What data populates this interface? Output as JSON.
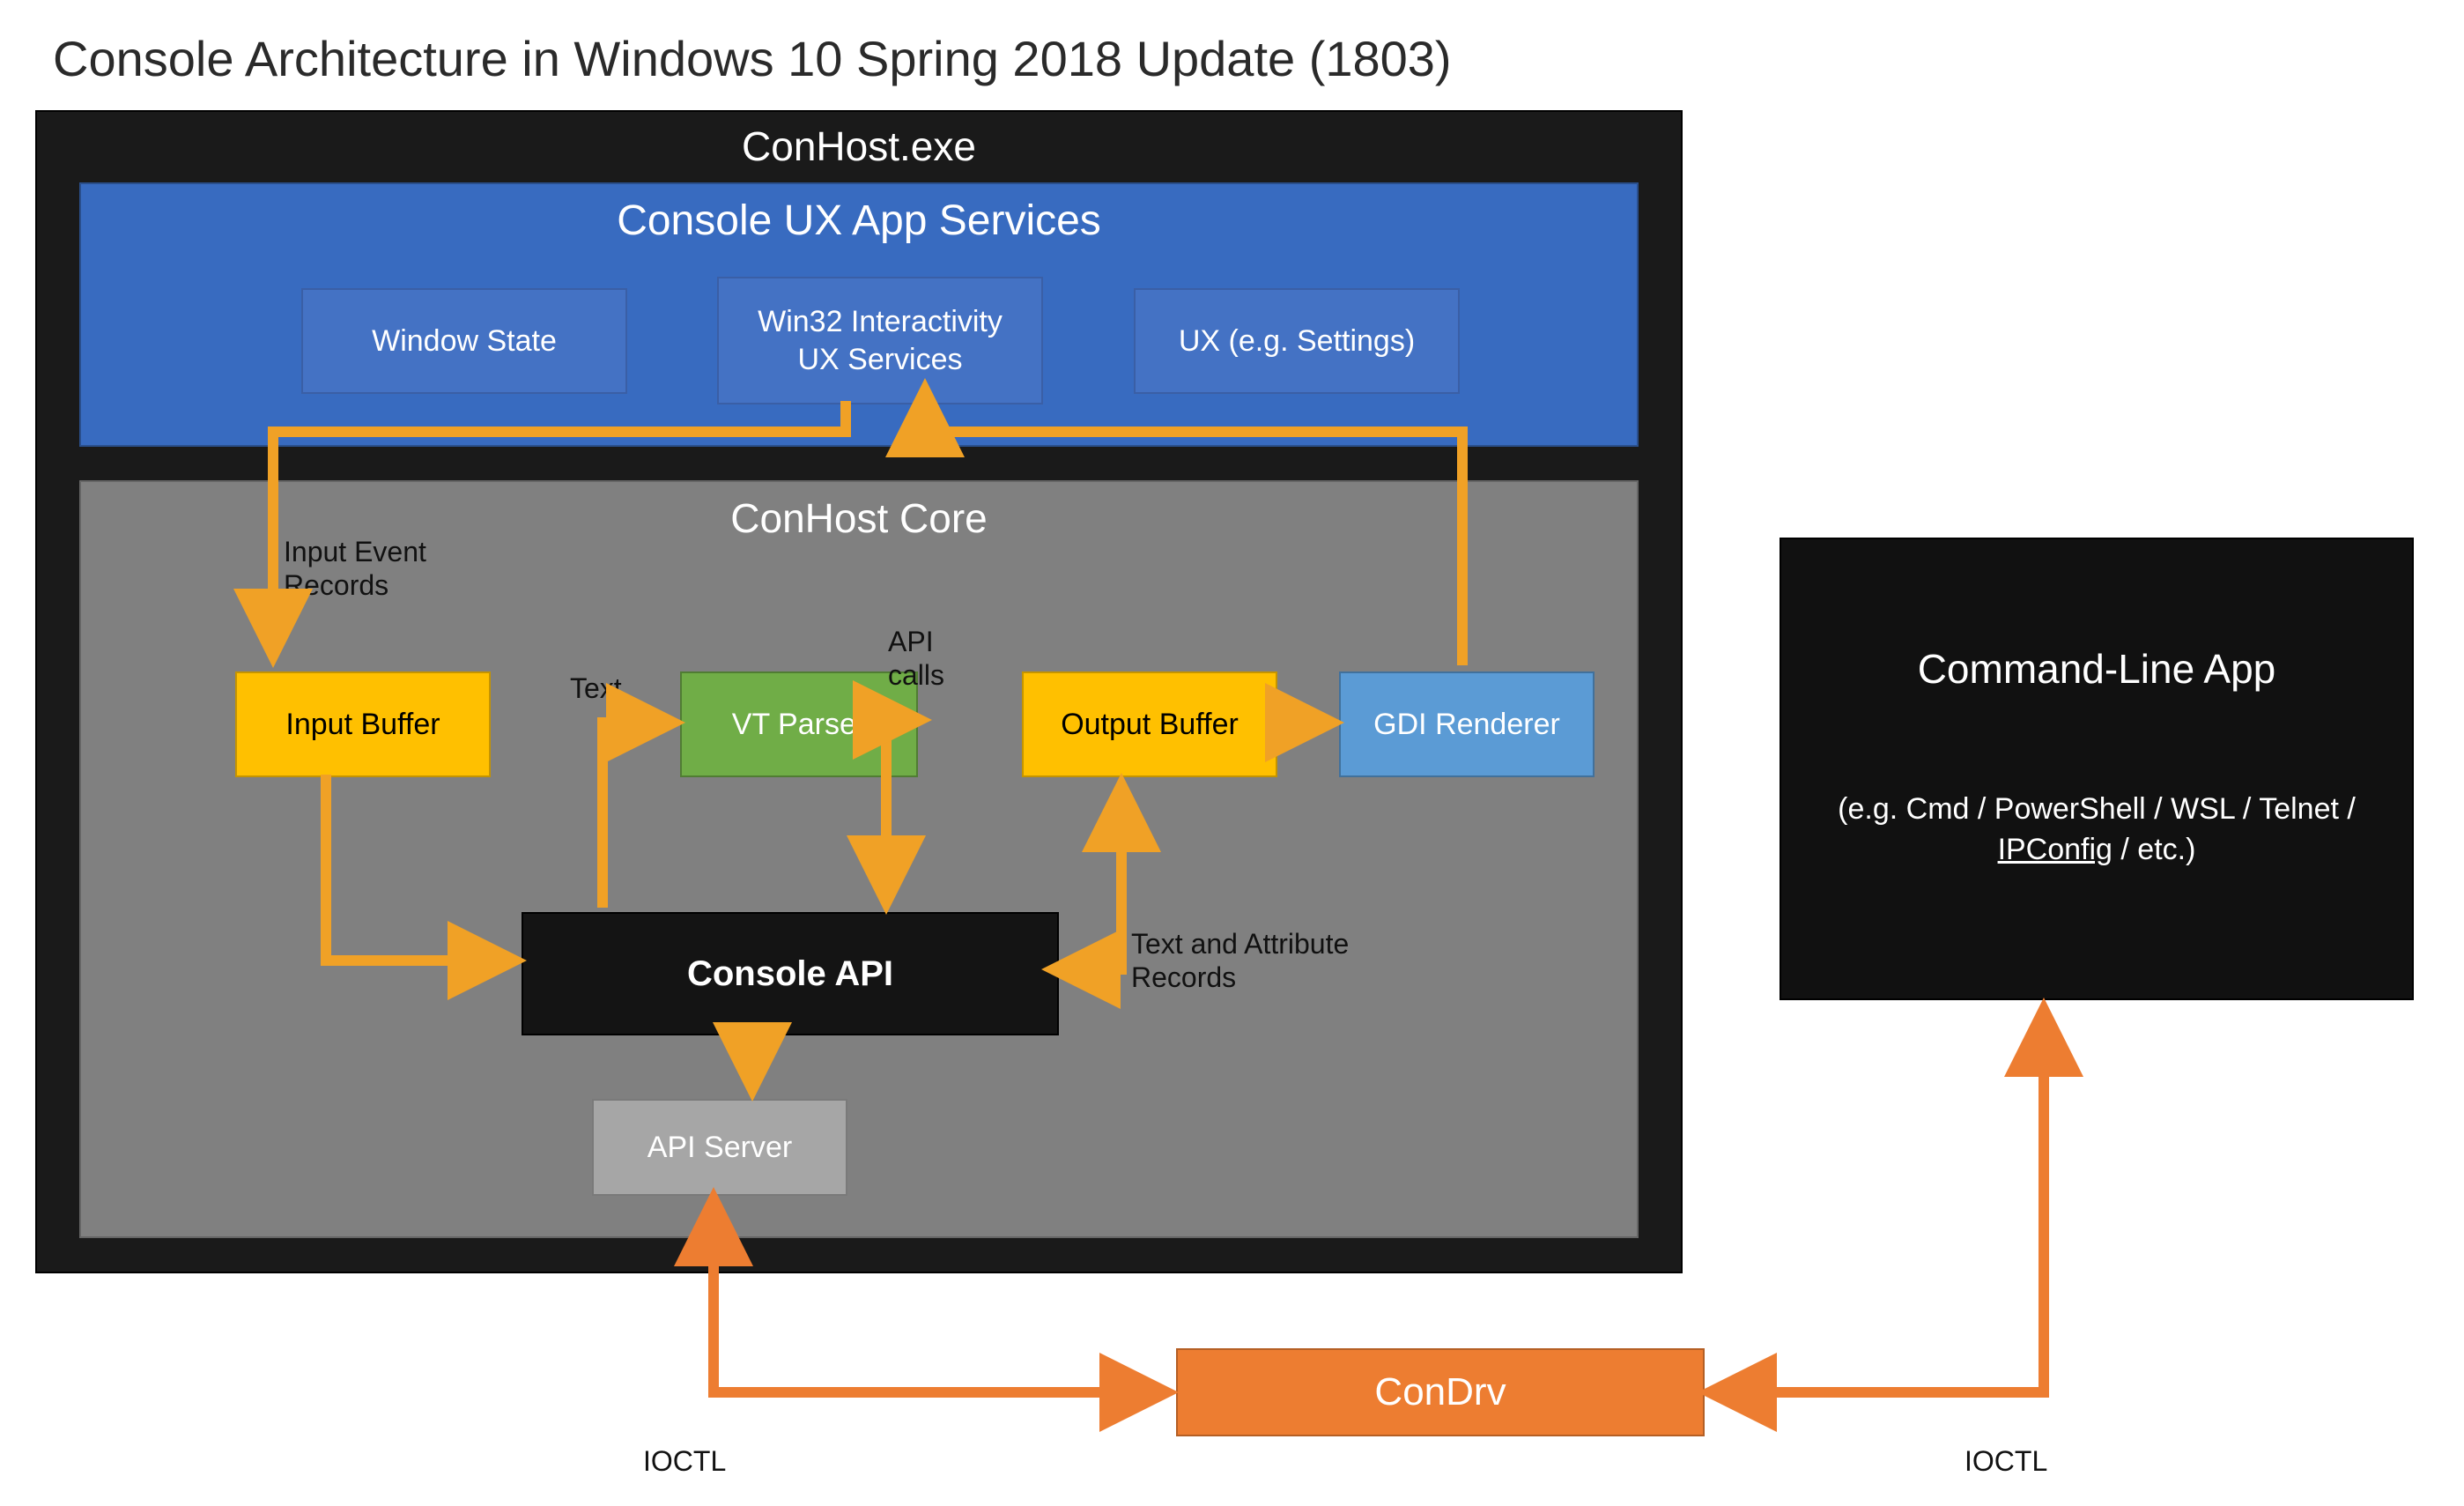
{
  "title": "Console Architecture in Windows 10 Spring 2018 Update (1803)",
  "conhost": {
    "label": "ConHost.exe"
  },
  "uxservices": {
    "title": "Console UX App Services",
    "window_state": "Window State",
    "interactivity": "Win32 Interactivity UX Services",
    "settings": "UX (e.g. Settings)"
  },
  "core": {
    "title": "ConHost Core",
    "input_buffer": "Input Buffer",
    "vt_parser": "VT Parser",
    "output_buffer": "Output Buffer",
    "gdi_renderer": "GDI Renderer",
    "console_api": "Console API",
    "api_server": "API Server",
    "labels": {
      "input_event_records": "Input Event Records",
      "text": "Text",
      "api_calls": "API calls",
      "text_attr": "Text and Attribute Records"
    }
  },
  "cli": {
    "title": "Command-Line App",
    "subtitle_pre": "(e.g. Cmd / PowerShell / WSL / Telnet / ",
    "subtitle_link": "IPConfig",
    "subtitle_post": " / etc.)"
  },
  "condrv": "ConDrv",
  "ioctl": "IOCTL",
  "colors": {
    "orange_arrow": "#f0a126",
    "condrv_fill": "#ed7d31",
    "uxsvc_fill": "#386bc0",
    "uxbox_fill": "#4472c4",
    "gold": "#ffc000",
    "green": "#70ad47",
    "blue": "#5b9bd5",
    "coregrey": "#808080",
    "black": "#141414"
  }
}
